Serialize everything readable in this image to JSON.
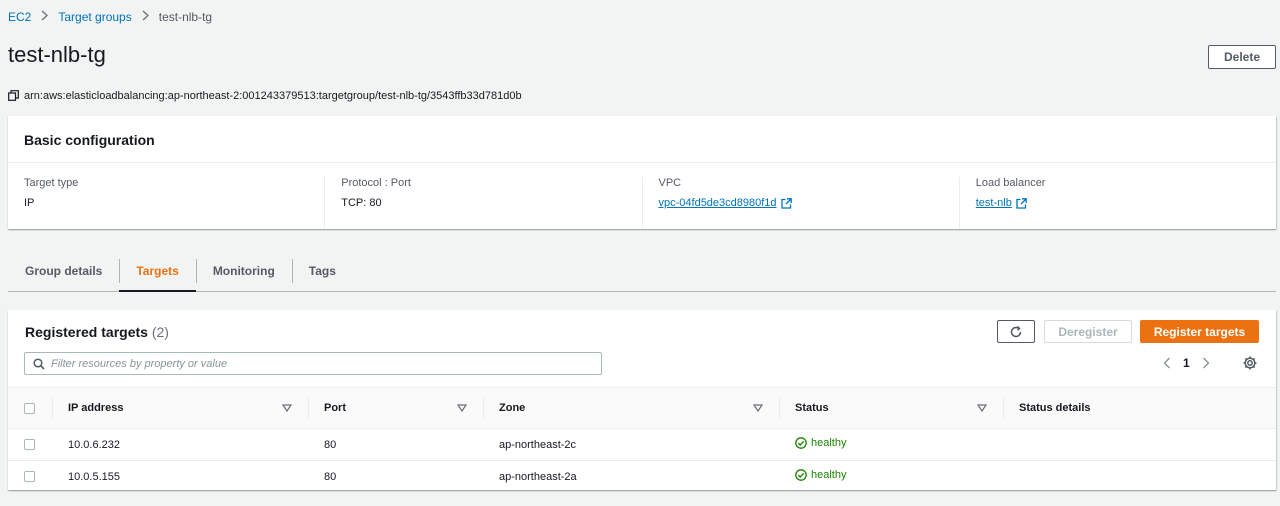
{
  "breadcrumb": {
    "items": [
      "EC2",
      "Target groups"
    ],
    "current": "test-nlb-tg"
  },
  "page": {
    "title": "test-nlb-tg",
    "delete_label": "Delete",
    "arn": "arn:aws:elasticloadbalancing:ap-northeast-2:001243379513:targetgroup/test-nlb-tg/3543ffb33d781d0b"
  },
  "basic_config": {
    "title": "Basic configuration",
    "target_type_label": "Target type",
    "target_type_value": "IP",
    "protocol_label": "Protocol : Port",
    "protocol_value": "TCP: 80",
    "vpc_label": "VPC",
    "vpc_value": "vpc-04fd5de3cd8980f1d",
    "lb_label": "Load balancer",
    "lb_value": "test-nlb"
  },
  "tabs": [
    "Group details",
    "Targets",
    "Monitoring",
    "Tags"
  ],
  "active_tab": "Targets",
  "targets": {
    "title": "Registered targets",
    "count": "(2)",
    "deregister_label": "Deregister",
    "register_label": "Register targets",
    "filter_placeholder": "Filter resources by property or value",
    "page": "1",
    "columns": [
      "IP address",
      "Port",
      "Zone",
      "Status",
      "Status details"
    ],
    "rows": [
      {
        "ip": "10.0.6.232",
        "port": "80",
        "zone": "ap-northeast-2c",
        "status": "healthy",
        "details": ""
      },
      {
        "ip": "10.0.5.155",
        "port": "80",
        "zone": "ap-northeast-2a",
        "status": "healthy",
        "details": ""
      }
    ]
  },
  "colors": {
    "accent": "#ec7211",
    "link": "#0073bb",
    "healthy": "#1d8102"
  }
}
